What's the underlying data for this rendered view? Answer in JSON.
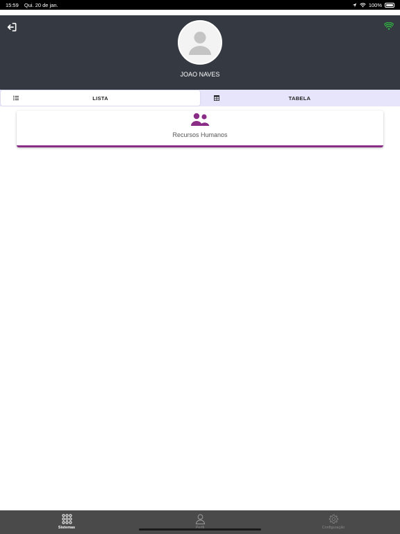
{
  "status_bar": {
    "time": "15:59",
    "date": "Qui. 20 de jan.",
    "battery": "100%"
  },
  "header": {
    "user_name": "JOAO NAVES",
    "background_color": "#353942",
    "logout_icon": "logout-icon",
    "wifi_icon": "wifi-icon",
    "wifi_color": "#2ecc40"
  },
  "view_tabs": [
    {
      "label": "LISTA",
      "icon": "list-icon",
      "active": true
    },
    {
      "label": "TABELA",
      "icon": "table-icon",
      "active": false
    }
  ],
  "systems": [
    {
      "label": "Recursos Humanos",
      "icon": "people-icon",
      "accent_color": "#8a2d86"
    }
  ],
  "bottom_nav": [
    {
      "label": "Sistemas",
      "icon": "grid-icon",
      "active": true
    },
    {
      "label": "Perfil",
      "icon": "user-icon",
      "active": false
    },
    {
      "label": "Configuração",
      "icon": "gear-icon",
      "active": false
    }
  ]
}
